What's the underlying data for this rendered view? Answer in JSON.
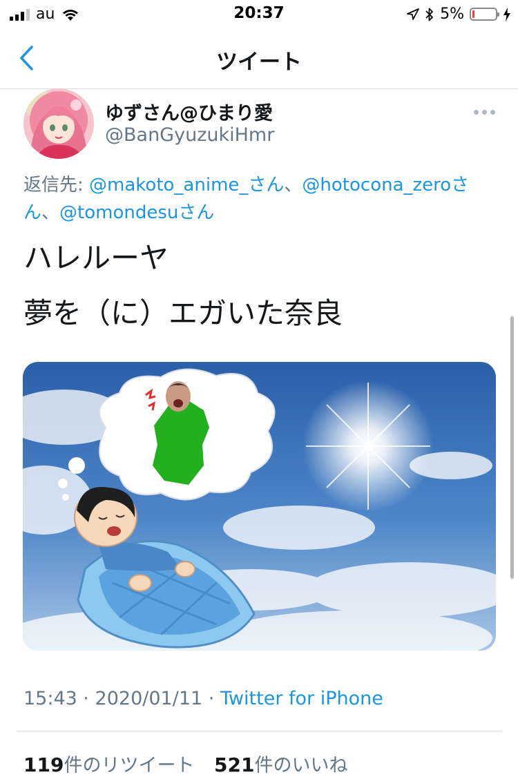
{
  "status": {
    "carrier": "au",
    "time": "20:37",
    "battery": "5%",
    "battery_level": 0.05,
    "icons": [
      "signal-icon",
      "wifi-icon",
      "location-icon",
      "bluetooth-icon",
      "battery-icon",
      "charging-icon"
    ]
  },
  "nav": {
    "title": "ツイート",
    "back_icon": "chevron-left-icon"
  },
  "tweet": {
    "author_name": "ゆずさん@ひまり愛",
    "handle": "@BanGyuzukiHmr",
    "reply_prefix": "返信先: ",
    "mention1": "@makoto_anime_さん",
    "sep1": "、",
    "mention2": "@hotocona_zeroさん",
    "sep2": "、",
    "mention3": "@tomondesuさん",
    "line1": "ハレルーヤ",
    "line2": "夢を（に）エガいた奈良",
    "timestamp": "15:43 · 2020/01/11 · ",
    "source": "Twitter for iPhone",
    "retweet_count": "119",
    "retweet_label": "件のリツイート",
    "like_count": "521",
    "like_label": "件のいいね"
  },
  "colors": {
    "accent": "#1b95e0",
    "secondary_text": "#657786",
    "text": "#14171a",
    "divider": "#d8dde0"
  }
}
